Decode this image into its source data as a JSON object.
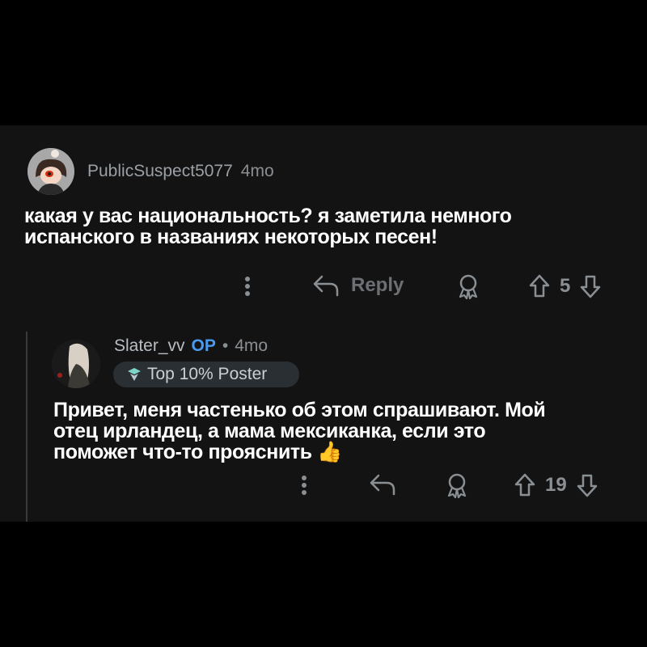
{
  "comment1": {
    "username": "PublicSuspect5077",
    "time": "4mo",
    "text_line1": "какая у вас национальность? я заметила немного",
    "text_line2": "испанского в названиях некоторых песен!",
    "reply_label": "Reply",
    "score": "5",
    "icons": [
      "more-vertical-icon",
      "reply-arrow-icon",
      "award-icon",
      "upvote-icon",
      "downvote-icon"
    ]
  },
  "comment2": {
    "username": "Slater_vv",
    "op_label": "OP",
    "separator": "•",
    "time": "4mo",
    "badge_label": "Top 10% Poster",
    "text_line1": "Привет, меня частенько об этом спрашивают. Мой",
    "text_line2": "отец ирландец, а мама мексиканка, если это",
    "text_line3": "поможет что-то прояснить",
    "emoji": "👍",
    "score": "19",
    "icons": [
      "more-vertical-icon",
      "reply-arrow-icon",
      "award-icon",
      "upvote-icon",
      "downvote-icon"
    ]
  },
  "colors": {
    "background": "#000000",
    "panel": "#131313",
    "muted_text": "#8a8f93",
    "op_accent": "#4a9bf0",
    "badge_bg": "#2a2f33"
  }
}
